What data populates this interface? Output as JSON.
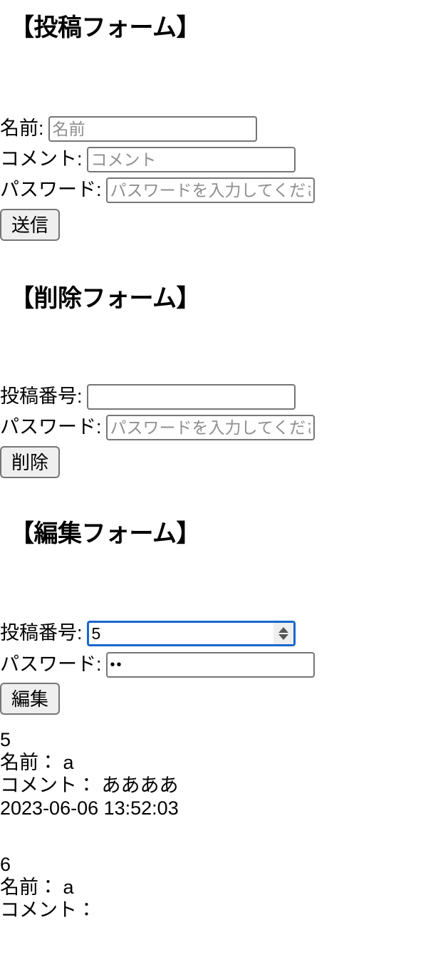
{
  "post_form": {
    "heading": "【投稿フォーム】",
    "name_label": "名前:",
    "name_placeholder": "名前",
    "name_value": "",
    "comment_label": "コメント:",
    "comment_placeholder": "コメント",
    "comment_value": "",
    "password_label": "パスワード:",
    "password_placeholder": "パスワードを入力してください",
    "password_value": "",
    "submit_label": "送信"
  },
  "delete_form": {
    "heading": "【削除フォーム】",
    "post_number_label": "投稿番号:",
    "post_number_value": "",
    "password_label": "パスワード:",
    "password_placeholder": "パスワードを入力してください",
    "password_value": "",
    "submit_label": "削除"
  },
  "edit_form": {
    "heading": "【編集フォーム】",
    "post_number_label": "投稿番号:",
    "post_number_value": "5",
    "post_number_focused": true,
    "password_label": "パスワード:",
    "password_value": "••",
    "password_raw_length": 2,
    "submit_label": "編集"
  },
  "posts": [
    {
      "id": "5",
      "name_line": "名前： a",
      "comment_line": "コメント： ああああ",
      "timestamp": "2023-06-06 13:52:03"
    },
    {
      "id": "6",
      "name_line": "名前： a",
      "comment_line": "コメント：",
      "timestamp": ""
    }
  ],
  "colors": {
    "page_background": "#ffffff",
    "text": "#000000",
    "placeholder": "#8f8f8f",
    "input_border": "#767676",
    "focus_border": "#1a66cc",
    "button_background": "#efefef",
    "spinner_background": "#efefef",
    "spinner_arrow": "#565656"
  }
}
